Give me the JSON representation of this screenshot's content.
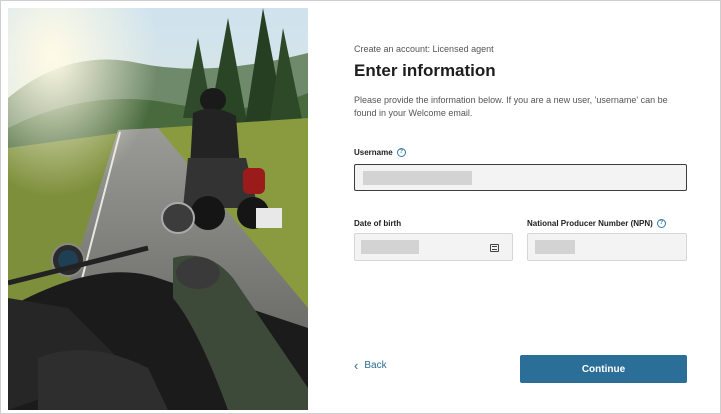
{
  "header": {
    "eyebrow": "Create an account: Licensed agent",
    "title": "Enter information",
    "description": "Please provide the information below. If you are a new user, 'username' can be found in your Welcome email."
  },
  "fields": {
    "username": {
      "label": "Username",
      "help_icon": "help-circle-icon"
    },
    "dob": {
      "label": "Date of birth",
      "icon": "calendar-icon"
    },
    "npn": {
      "label": "National Producer Number (NPN)",
      "help_icon": "help-circle-icon"
    }
  },
  "actions": {
    "back_label": "Back",
    "continue_label": "Continue"
  },
  "colors": {
    "accent": "#2b6f98",
    "link": "#2a6b94",
    "field_bg": "#f3f3f3"
  },
  "image": {
    "subject": "photo"
  }
}
